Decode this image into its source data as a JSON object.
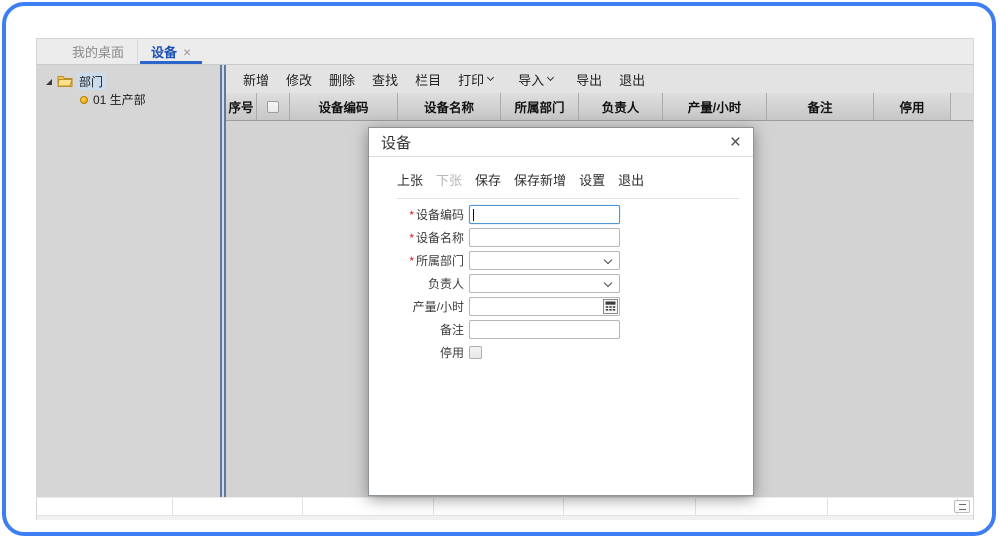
{
  "glyphs": {
    "close": "×"
  },
  "colors": {
    "accent_blue": "#2a66cc",
    "required_red": "#cc2222",
    "frame_blue": "#3d7ef2"
  },
  "tabs": [
    {
      "name": "my-desktop",
      "label": "我的桌面",
      "active": false,
      "closable": false
    },
    {
      "name": "device",
      "label": "设备",
      "active": true,
      "closable": true
    }
  ],
  "tree": {
    "root": {
      "name": "department",
      "label": "部门",
      "expanded": true,
      "selected": true
    },
    "children": [
      {
        "name": "production-dept",
        "label": "01 生产部"
      }
    ]
  },
  "toolbar": {
    "items": [
      {
        "name": "new",
        "label": "新增",
        "dropdown": false
      },
      {
        "name": "edit",
        "label": "修改",
        "dropdown": false
      },
      {
        "name": "delete",
        "label": "删除",
        "dropdown": false
      },
      {
        "name": "find",
        "label": "查找",
        "dropdown": false
      },
      {
        "name": "columns",
        "label": "栏目",
        "dropdown": false
      },
      {
        "name": "print",
        "label": "打印",
        "dropdown": true
      },
      {
        "name": "import",
        "label": "导入",
        "dropdown": true
      },
      {
        "name": "export",
        "label": "导出",
        "dropdown": false
      },
      {
        "name": "exit",
        "label": "退出",
        "dropdown": false
      }
    ]
  },
  "grid": {
    "columns": [
      {
        "name": "seq",
        "label": "序号",
        "type": "text"
      },
      {
        "name": "select-all",
        "label": "",
        "type": "checkbox"
      },
      {
        "name": "device-code",
        "label": "设备编码",
        "type": "text"
      },
      {
        "name": "device-name",
        "label": "设备名称",
        "type": "text"
      },
      {
        "name": "department",
        "label": "所属部门",
        "type": "text"
      },
      {
        "name": "manager",
        "label": "负责人",
        "type": "text"
      },
      {
        "name": "output-per-hour",
        "label": "产量/小时",
        "type": "text"
      },
      {
        "name": "remark",
        "label": "备注",
        "type": "text"
      },
      {
        "name": "disabled",
        "label": "停用",
        "type": "text"
      }
    ],
    "rows": []
  },
  "dialog": {
    "title": "设备",
    "toolbar": [
      {
        "name": "prev",
        "label": "上张",
        "disabled": false
      },
      {
        "name": "next",
        "label": "下张",
        "disabled": true
      },
      {
        "name": "save",
        "label": "保存",
        "disabled": false
      },
      {
        "name": "save-new",
        "label": "保存新增",
        "disabled": false
      },
      {
        "name": "settings",
        "label": "设置",
        "disabled": false
      },
      {
        "name": "exit",
        "label": "退出",
        "disabled": false
      }
    ],
    "fields": [
      {
        "name": "device-code",
        "label": "设备编码",
        "required": true,
        "type": "text",
        "value": "",
        "placeholder": "",
        "focused": true
      },
      {
        "name": "device-name",
        "label": "设备名称",
        "required": true,
        "type": "text",
        "value": "",
        "placeholder": "",
        "focused": false
      },
      {
        "name": "department",
        "label": "所属部门",
        "required": true,
        "type": "select",
        "value": "",
        "focused": false
      },
      {
        "name": "manager",
        "label": "负责人",
        "required": false,
        "type": "select",
        "value": "",
        "focused": false
      },
      {
        "name": "output-per-hour",
        "label": "产量/小时",
        "required": false,
        "type": "number",
        "value": "",
        "focused": false
      },
      {
        "name": "remark",
        "label": "备注",
        "required": false,
        "type": "text",
        "value": "",
        "placeholder": "",
        "focused": false
      },
      {
        "name": "disabled",
        "label": "停用",
        "required": false,
        "type": "checkbox",
        "checked": false,
        "focused": false
      }
    ]
  }
}
